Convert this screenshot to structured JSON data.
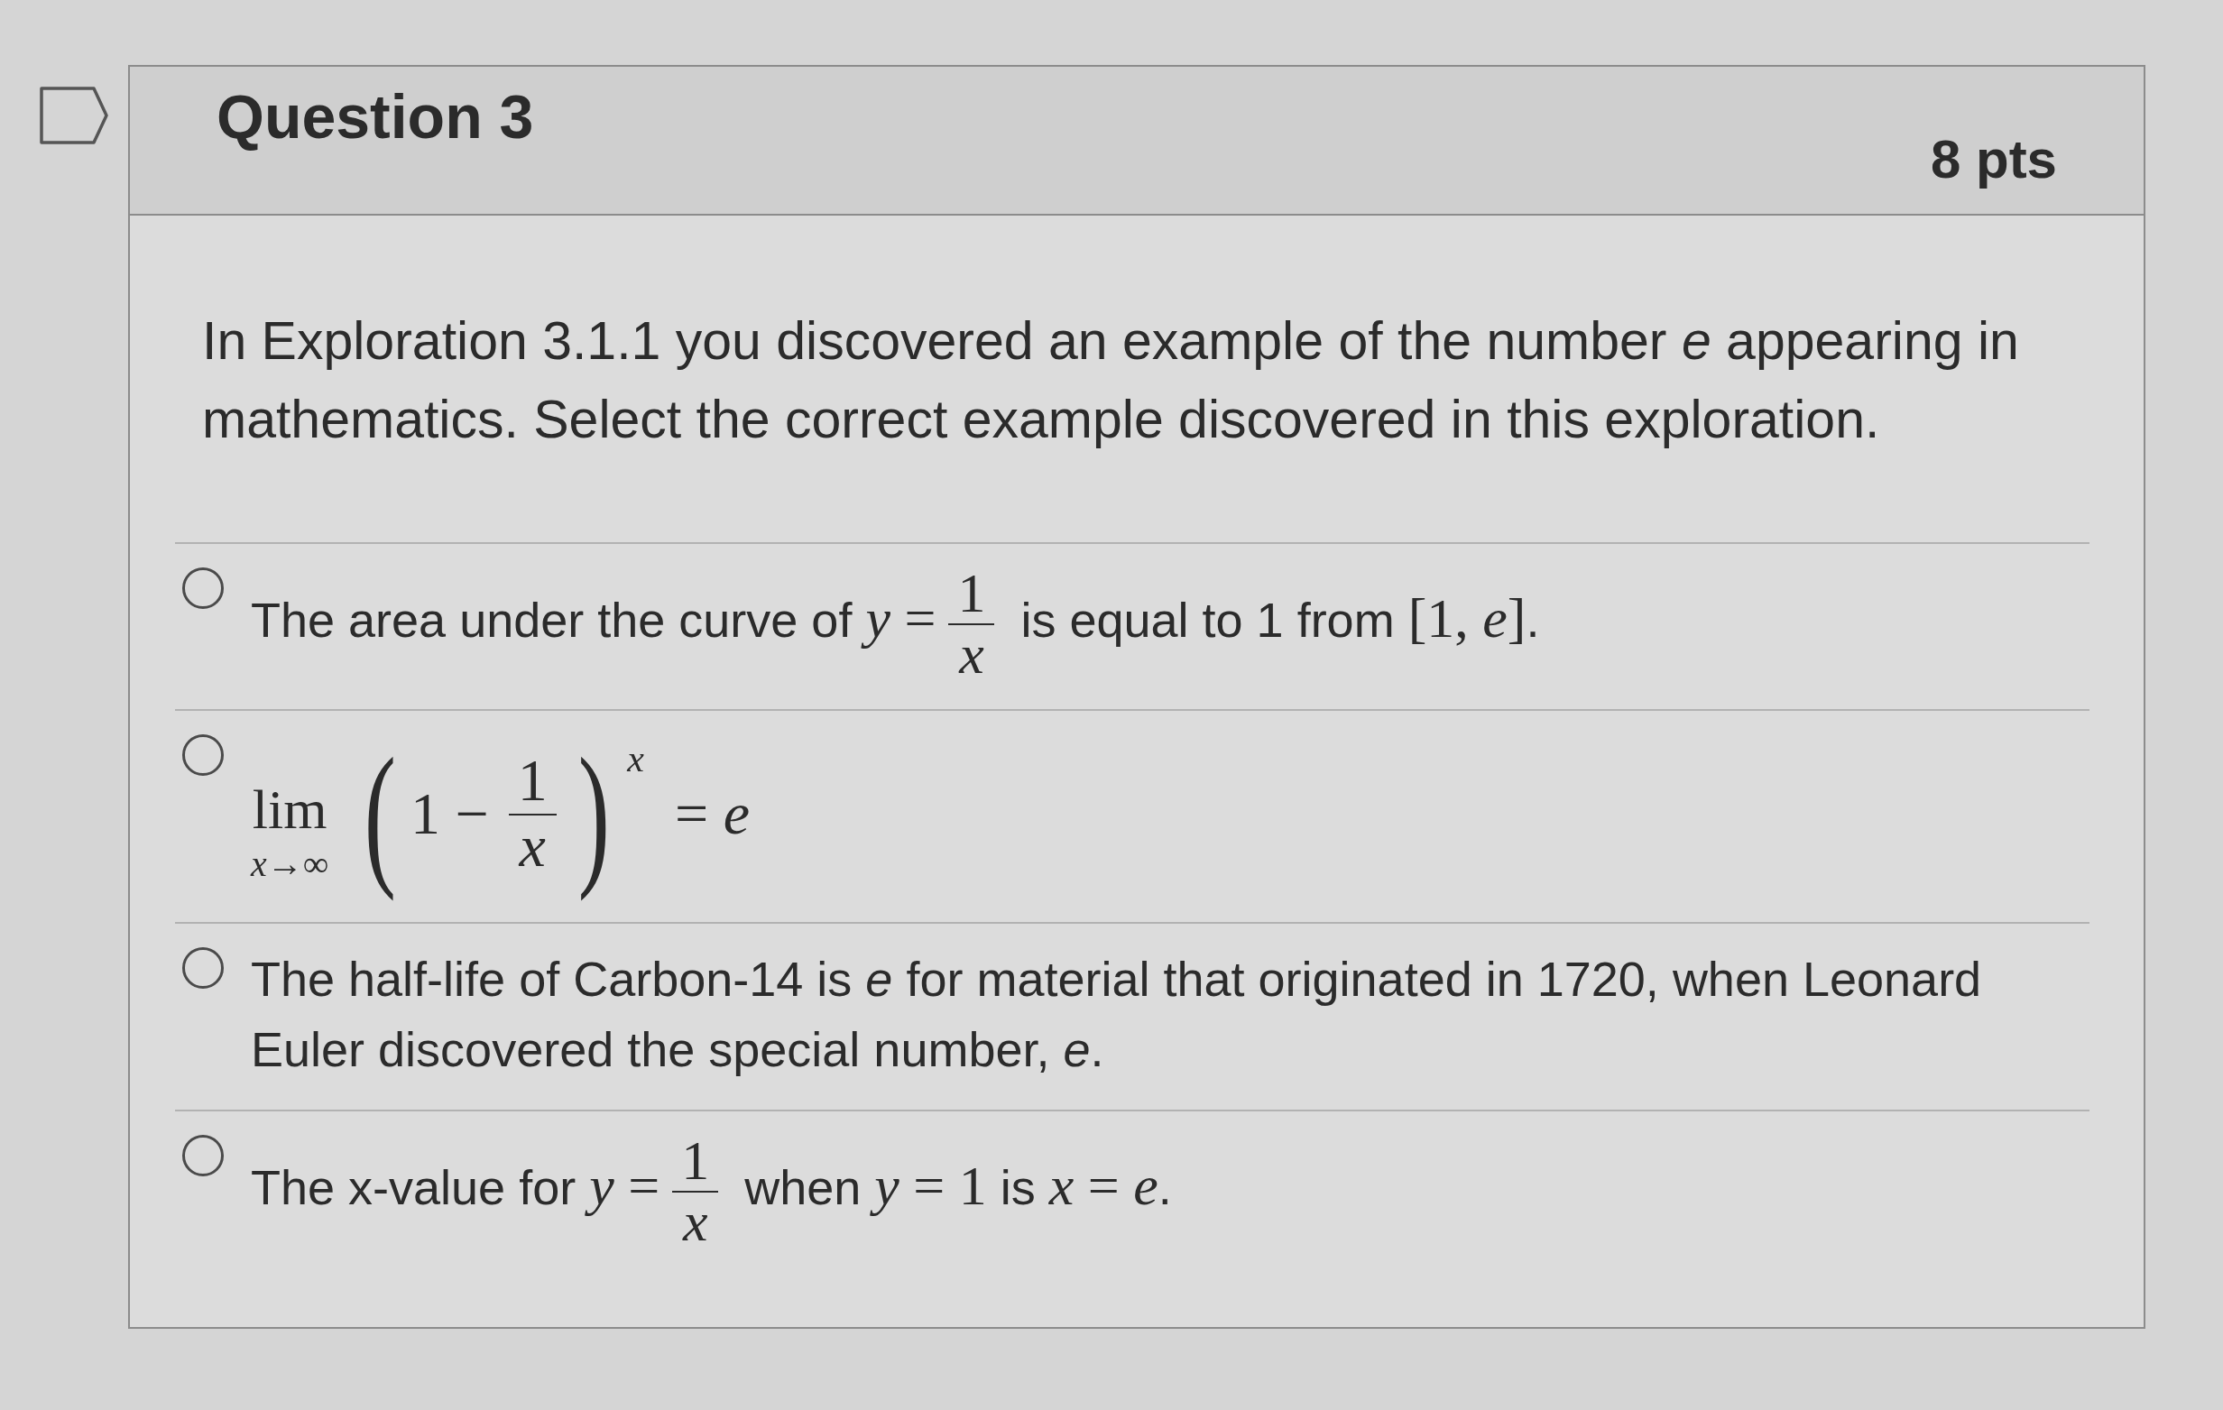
{
  "question": {
    "title": "Question 3",
    "points": "8 pts",
    "flagged": false,
    "text": "In Exploration 3.1.1 you discovered an example of the number *e* appearing in mathematics. Select the correct example discovered in this exploration.",
    "answers": [
      {
        "selected": false,
        "parts": [
          {
            "kind": "text",
            "text": "The area under the curve of "
          },
          {
            "kind": "math",
            "text": "y ="
          },
          {
            "kind": "frac",
            "num": "1",
            "den": "x"
          },
          {
            "kind": "text",
            "text": " is equal to 1 from "
          },
          {
            "kind": "math",
            "text": "[1, e]"
          },
          {
            "kind": "text",
            "text": "."
          }
        ]
      },
      {
        "selected": false,
        "parts": [
          {
            "kind": "limit",
            "text": "lim",
            "sub": "x→∞"
          },
          {
            "kind": "group",
            "open": "(",
            "close": ")",
            "sup": "x",
            "parts": [
              {
                "kind": "math",
                "text": "1 −"
              },
              {
                "kind": "frac",
                "num": "1",
                "den": "x"
              }
            ]
          },
          {
            "kind": "math",
            "text": "= e"
          }
        ]
      },
      {
        "selected": false,
        "parts": [
          {
            "kind": "text",
            "text": "The half-life of Carbon-14 is *e* for material that originated in 1720, when Leonard Euler discovered the special number, *e*."
          }
        ]
      },
      {
        "selected": false,
        "parts": [
          {
            "kind": "text",
            "text": "The x-value for "
          },
          {
            "kind": "math",
            "text": "y ="
          },
          {
            "kind": "frac",
            "num": "1",
            "den": "x"
          },
          {
            "kind": "text",
            "text": " when "
          },
          {
            "kind": "math",
            "text": "y = 1"
          },
          {
            "kind": "text",
            "text": " is "
          },
          {
            "kind": "math",
            "text": "x = e"
          },
          {
            "kind": "text",
            "text": "."
          }
        ]
      }
    ]
  }
}
